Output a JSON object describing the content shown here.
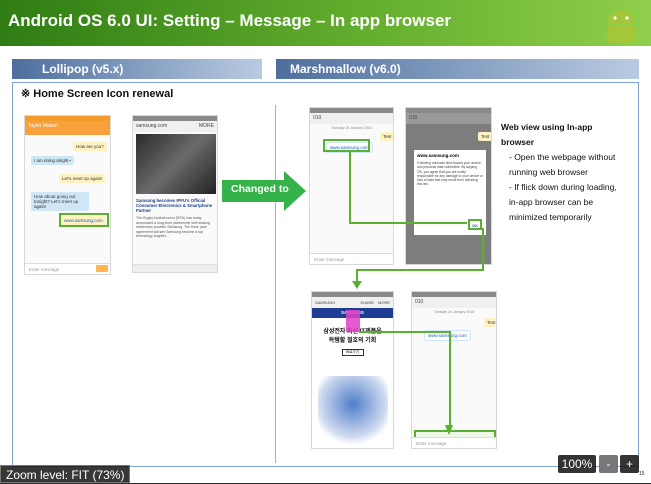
{
  "slide": {
    "title": "Android OS 6.0 UI: Setting – Message – In app browser",
    "lollipop_header": "Lollipop (v5.x)",
    "marshmallow_header": "Marshmallow (v6.0)",
    "section_title": "※ Home Screen Icon renewal",
    "changed_to": "Changed to",
    "page_number": "15"
  },
  "lollipop": {
    "contact_name": "Taylor Mason",
    "messages": [
      "How are you?",
      "I am doing alright~",
      "Let's meet up again!",
      "How about going out tonight? Let's meet up again!",
      "www.samsung.com"
    ],
    "input_placeholder": "Enter message",
    "browser_url": "samsung.com",
    "browser_more": "MORE",
    "article_title": "Samsung becomes IPFU's Official Consumer Electronics & Smartphone Partner",
    "article_body": "The Rugby football union (RFU) has today announced a long-term partnership with leading electronics provider Samsung. The three year agreement will see Samsung become a top technology supplier..."
  },
  "marshmallow": {
    "number": "010",
    "date": "Tuesday 24 January 2016",
    "test_msg": "Test",
    "link": "www.samsung.com",
    "input_placeholder": "Enter message",
    "dialog_title": "www.samsung.com",
    "dialog_body": "Following unknown links leaves your device and personal data vulnerable. By tapping OK, you agree that you are solely responsible for any damage to your device or loss of data that may result from following this link.",
    "dialog_ok": "OK",
    "browser_site": "SAMSUNG",
    "browser_share": "SHARE",
    "browser_more": "MORE",
    "browser_brand": "SAMSUNG",
    "browser_headline1": "삼성전자 최신 IT제품을",
    "browser_headline2": "득템할 절호의 기회",
    "browser_button": "바로가기"
  },
  "description": {
    "heading": "Web view using In-app browser",
    "bullets": [
      "- Open the webpage without running web browser",
      "- If flick down during loading, in-app browser can be minimized temporarily"
    ]
  },
  "viewer": {
    "zoom_label": "Zoom level: FIT (73%)",
    "zoom_button": "100%",
    "minus": "-",
    "plus": "+"
  }
}
